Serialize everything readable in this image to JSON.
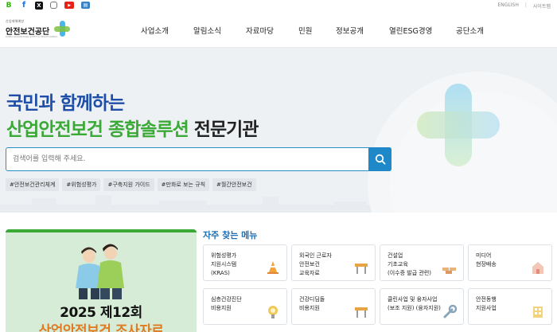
{
  "sns": {
    "items": [
      {
        "name": "blog-icon",
        "glyph": "B"
      },
      {
        "name": "facebook-icon",
        "glyph": "f"
      },
      {
        "name": "x-icon",
        "glyph": "X"
      },
      {
        "name": "instagram-icon",
        "glyph": ""
      },
      {
        "name": "youtube-icon",
        "glyph": "▶"
      },
      {
        "name": "ebook-icon",
        "glyph": "▤"
      }
    ]
  },
  "util": {
    "english": "ENGLISH",
    "separator": "|",
    "sitemap": "사이트맵"
  },
  "logo": {
    "small": "산업재해예방",
    "name": "안전보건공단",
    "en": "KOREA OCCUPATIONAL SAFETY & HEALTH AGENCY"
  },
  "nav": {
    "items": [
      "사업소개",
      "알림소식",
      "자료마당",
      "민원",
      "정보공개",
      "열린ESG경영",
      "공단소개"
    ]
  },
  "hero": {
    "headline1": "국민과 함께하는",
    "headline2_green": "산업안전보건 종합솔루션",
    "headline2_dark": " 전문기관",
    "search_placeholder": "검색어를 입력해 주세요.",
    "tags": [
      "#안전보건관리체계",
      "#위험성평가",
      "#구축지원 가이드",
      "#만화로 보는 규칙",
      "#월간안전보건"
    ]
  },
  "promo": {
    "title": "2025 제12회",
    "subtitle": "산업안전보건 조사자료"
  },
  "favorites": {
    "title": "자주 찾는 메뉴",
    "cards": [
      {
        "label": "위험성평가\n지원시스템\n(KRAS)",
        "icon": "cone-icon"
      },
      {
        "label": "외국인 근로자\n안전보건\n교육자료",
        "icon": "barrier-icon"
      },
      {
        "label": "건설업\n기초교육\n(이수증 발급 관련)",
        "icon": "bricks-icon"
      },
      {
        "label": "미디어\n현장배송",
        "icon": "house-icon"
      },
      {
        "label": "심층건강진단\n비용지원",
        "icon": "medal-icon"
      },
      {
        "label": "건강디딤돌\n비용지원",
        "icon": "barrier-icon"
      },
      {
        "label": "클린사업 및 융자사업\n(보조 지원) (융자지원)",
        "icon": "wrench-icon"
      },
      {
        "label": "안전동행\n지원사업",
        "icon": "building-icon"
      }
    ]
  },
  "colors": {
    "brand_blue": "#1f4ea8",
    "brand_green": "#3aa935",
    "search_blue": "#1e88c9",
    "promo_orange": "#e07b21"
  }
}
